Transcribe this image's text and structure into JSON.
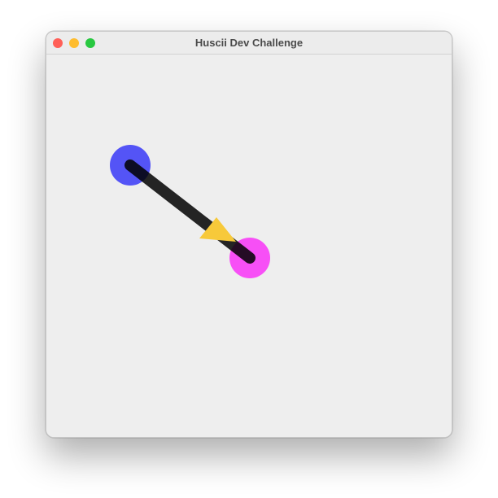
{
  "window": {
    "title": "Huscii Dev Challenge",
    "controls": {
      "close_color": "#ff5f57",
      "minimize_color": "#febc2e",
      "zoom_color": "#28c840"
    }
  },
  "canvas": {
    "background": "#eeeeee",
    "start_node_color": "#4b4bf5",
    "end_node_color": "#f746f5",
    "connector_color": "#000000",
    "arrowhead_color": "#f7c93a",
    "start_node_icon": "circle",
    "end_node_icon": "circle",
    "arrowhead_icon": "arrowhead"
  }
}
